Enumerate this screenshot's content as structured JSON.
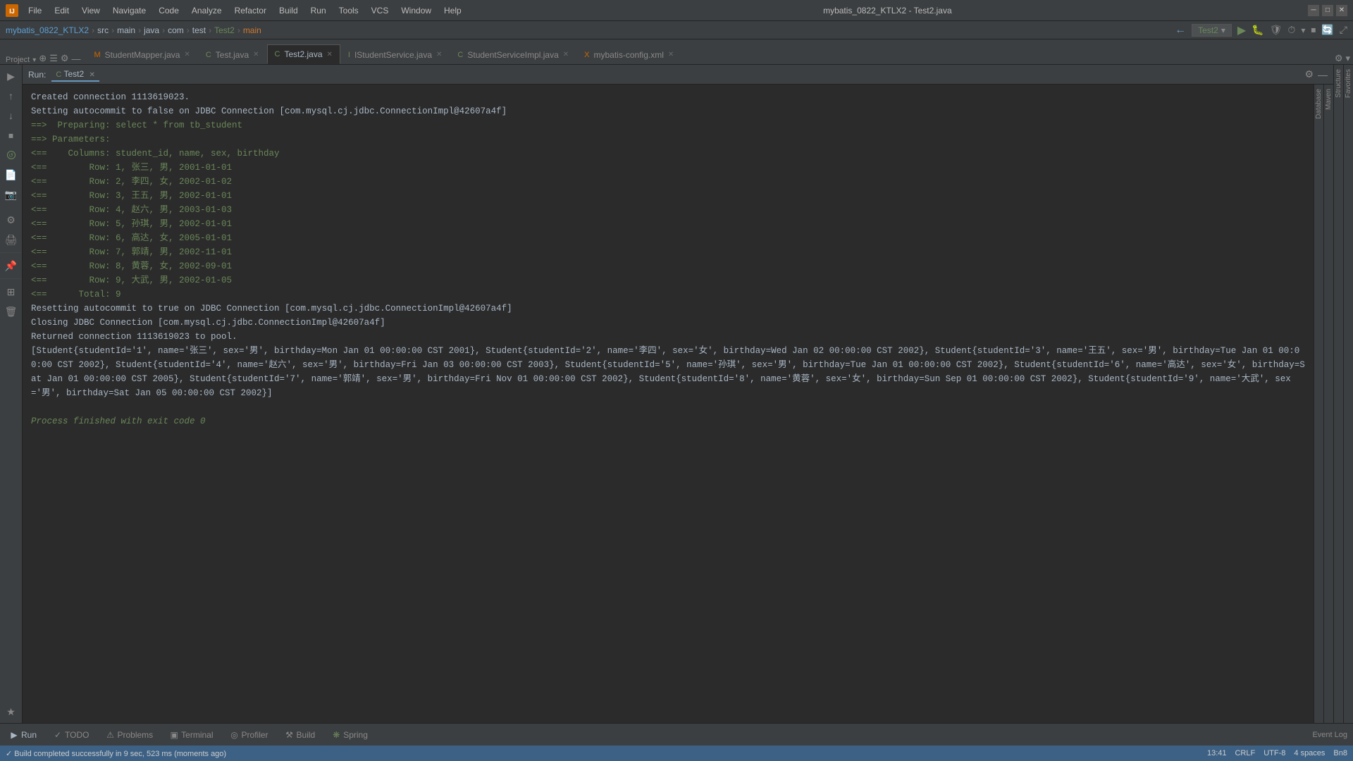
{
  "titleBar": {
    "appName": "IntelliJ IDEA",
    "title": "mybatis_0822_KTLX2 - Test2.java",
    "menu": [
      "File",
      "Edit",
      "View",
      "Navigate",
      "Code",
      "Analyze",
      "Refactor",
      "Build",
      "Run",
      "Tools",
      "VCS",
      "Window",
      "Help"
    ]
  },
  "breadcrumb": {
    "items": [
      "mybatis_0822_KTLX2",
      "src",
      "main",
      "java",
      "com",
      "test",
      "Test2",
      "main"
    ],
    "runConfig": "Test2"
  },
  "fileTabs": [
    {
      "label": "StudentMapper.java",
      "type": "mapper",
      "active": false,
      "color": "#cc6600"
    },
    {
      "label": "Test.java",
      "type": "test",
      "active": false,
      "color": "#6a8759"
    },
    {
      "label": "Test2.java",
      "type": "test",
      "active": true,
      "color": "#6a8759"
    },
    {
      "label": "IStudentService.java",
      "type": "interface",
      "active": false,
      "color": "#6a8759"
    },
    {
      "label": "StudentServiceImpl.java",
      "type": "impl",
      "active": false,
      "color": "#6a8759"
    },
    {
      "label": "mybatis-config.xml",
      "type": "xml",
      "active": false,
      "color": "#cc6600"
    }
  ],
  "runPanel": {
    "title": "Run:",
    "tabLabel": "Test2",
    "settingsTooltip": "Settings",
    "closeTooltip": "Close"
  },
  "consoleOutput": [
    {
      "text": "Created connection 1113619023.",
      "type": "normal"
    },
    {
      "text": "Setting autocommit to false on JDBC Connection [com.mysql.cj.jdbc.ConnectionImpl@42607a4f]",
      "type": "normal"
    },
    {
      "text": "==>  Preparing: select * from tb_student",
      "type": "arrow"
    },
    {
      "text": "==> Parameters: ",
      "type": "arrow"
    },
    {
      "text": "<==    Columns: student_id, name, sex, birthday",
      "type": "arrow-left"
    },
    {
      "text": "<==        Row: 1, 张三, 男, 2001-01-01",
      "type": "arrow-left"
    },
    {
      "text": "<==        Row: 2, 李四, 女, 2002-01-02",
      "type": "arrow-left"
    },
    {
      "text": "<==        Row: 3, 王五, 男, 2002-01-01",
      "type": "arrow-left"
    },
    {
      "text": "<==        Row: 4, 赵六, 男, 2003-01-03",
      "type": "arrow-left"
    },
    {
      "text": "<==        Row: 5, 孙琪, 男, 2002-01-01",
      "type": "arrow-left"
    },
    {
      "text": "<==        Row: 6, 高达, 女, 2005-01-01",
      "type": "arrow-left"
    },
    {
      "text": "<==        Row: 7, 郭靖, 男, 2002-11-01",
      "type": "arrow-left"
    },
    {
      "text": "<==        Row: 8, 黄蓉, 女, 2002-09-01",
      "type": "arrow-left"
    },
    {
      "text": "<==        Row: 9, 大武, 男, 2002-01-05",
      "type": "arrow-left"
    },
    {
      "text": "<==      Total: 9",
      "type": "arrow-left"
    },
    {
      "text": "Resetting autocommit to true on JDBC Connection [com.mysql.cj.jdbc.ConnectionImpl@42607a4f]",
      "type": "normal"
    },
    {
      "text": "Closing JDBC Connection [com.mysql.cj.jdbc.ConnectionImpl@42607a4f]",
      "type": "normal"
    },
    {
      "text": "Returned connection 1113619023 to pool.",
      "type": "normal"
    },
    {
      "text": "[Student{studentId='1', name='张三', sex='男', birthday=Mon Jan 01 00:00:00 CST 2001}, Student{studentId='2', name='李四', sex='女', birthday=Wed Jan 02 00:00:00 CST 2002}, Student{studentId='3', name='王五', sex='男', birthday=Tue Jan 01 00:00:00 CST 2002}, Student{studentId='4', name='赵六', sex='男', birthday=Fri Jan 03 00:00:00 CST 2003}, Student{studentId='5', name='孙琪', sex='男', birthday=Tue Jan 01 00:00:00 CST 2002}, Student{studentId='6', name='高达', sex='女', birthday=Sat Jan 01 00:00:00 CST 2005}, Student{studentId='7', name='郭靖', sex='男', birthday=Fri Nov 01 00:00:00 CST 2002}, Student{studentId='8', name='黄蓉', sex='女', birthday=Sun Sep 01 00:00:00 CST 2002}, Student{studentId='9', name='大武', sex='男', birthday=Sat Jan 05 00:00:00 CST 2002}]",
      "type": "normal"
    },
    {
      "text": "",
      "type": "blank"
    },
    {
      "text": "Process finished with exit code 0",
      "type": "finished"
    }
  ],
  "bottomTabs": [
    {
      "label": "Run",
      "icon": "▶",
      "active": true
    },
    {
      "label": "TODO",
      "icon": "✓",
      "active": false
    },
    {
      "label": "Problems",
      "icon": "⚠",
      "active": false
    },
    {
      "label": "Terminal",
      "icon": "⬛",
      "active": false
    },
    {
      "label": "Profiler",
      "icon": "◎",
      "active": false
    },
    {
      "label": "Build",
      "icon": "🔨",
      "active": false
    },
    {
      "label": "Spring",
      "icon": "🍃",
      "active": false
    }
  ],
  "statusBar": {
    "buildStatus": "Build completed successfully in 9 sec, 523 ms (moments ago)",
    "time": "13:41",
    "lineEnding": "CRLF",
    "encoding": "UTF-8",
    "indent": "4 spaces",
    "eventLog": "Event Log",
    "branch": "Bn8"
  },
  "sidebarLabels": {
    "project": "Project",
    "structure": "Structure",
    "favorites": "Favorites",
    "database": "Database",
    "maven": "Maven"
  }
}
